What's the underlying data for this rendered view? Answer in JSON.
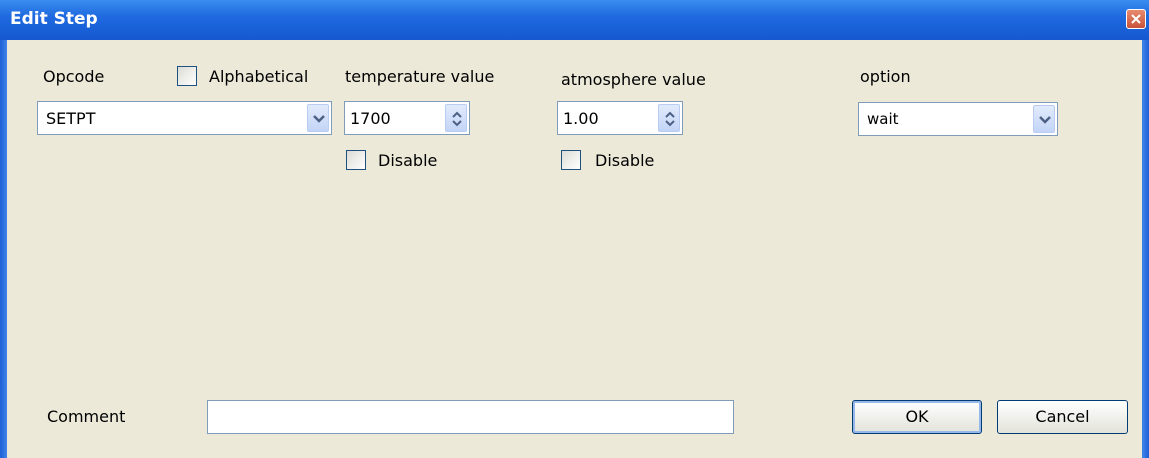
{
  "window": {
    "title": "Edit Step"
  },
  "opcode": {
    "label": "Opcode",
    "value": "SETPT"
  },
  "alphabetical": {
    "label": "Alphabetical",
    "checked": false
  },
  "temperature": {
    "label": "temperature value",
    "value": "1700",
    "disable_label": "Disable",
    "disabled": false
  },
  "atmosphere": {
    "label": "atmosphere value",
    "value": "1.00",
    "disable_label": "Disable",
    "disabled": false
  },
  "option": {
    "label": "option",
    "value": "wait"
  },
  "comment": {
    "label": "Comment",
    "value": ""
  },
  "buttons": {
    "ok": "OK",
    "cancel": "Cancel"
  },
  "icons": {
    "close": "close-icon",
    "dropdown": "chevron-down-icon",
    "spin": "spin-arrows-icon"
  },
  "colors": {
    "titlebar": "#1f6ae0",
    "background": "#ece9d8",
    "close": "#c8533a"
  }
}
